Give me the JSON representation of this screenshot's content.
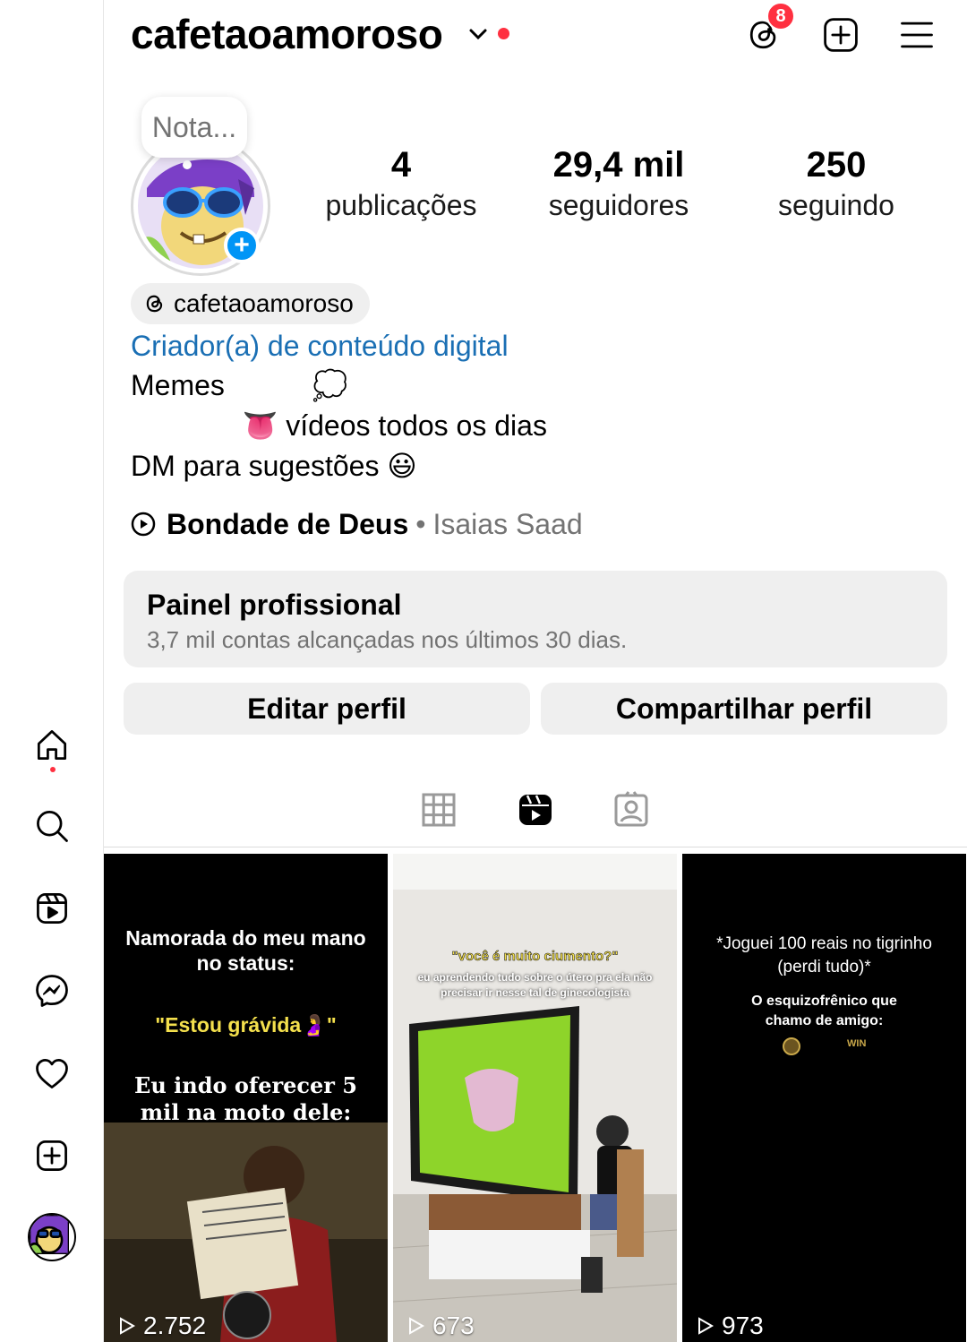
{
  "profile": {
    "username": "cafetaoamoroso",
    "note": "Nota...",
    "threads_badge_count": "8",
    "threads_handle": "cafetaoamoroso",
    "category": "Criador(a) de conteúdo digital",
    "bio_lines": [
      "Memes           💭",
      "              👅 vídeos todos os dias",
      "DM para sugestões 😃"
    ]
  },
  "stats": {
    "posts": {
      "value": "4",
      "label": "publicações"
    },
    "followers": {
      "value": "29,4 mil",
      "label": "seguidores"
    },
    "following": {
      "value": "250",
      "label": "seguindo"
    }
  },
  "music": {
    "song": "Bondade de Deus",
    "separator": "•",
    "artist": "Isaias Saad"
  },
  "panel": {
    "title": "Painel profissional",
    "subtitle": "3,7 mil contas alcançadas nos últimos 30 dias."
  },
  "buttons": {
    "edit": "Editar perfil",
    "share": "Compartilhar perfil"
  },
  "tabs": [
    {
      "icon": "grid-icon",
      "active": false
    },
    {
      "icon": "reels-icon",
      "active": true
    },
    {
      "icon": "tagged-icon",
      "active": false
    }
  ],
  "reels": [
    {
      "views": "2.752",
      "caption_top": "Namorada do meu mano no status:",
      "caption_mid": "\"Estou grávida🤰\"",
      "caption_bottom": "Eu indo oferecer 5 mil na moto dele:"
    },
    {
      "views": "673",
      "caption_top": "\"você é muito ciumento?\"",
      "caption_sub": "eu aprendendo tudo sobre o útero pra ela não precisar ir nesse tal de ginecologista"
    },
    {
      "views": "973",
      "caption_top": "*Joguei 100 reais no tigrinho (perdi tudo)*",
      "caption_mid": "O esquizofrênico que chamo de amigo:",
      "caption_small": "WIN"
    }
  ],
  "nav": [
    "home-icon",
    "search-icon",
    "reels-icon",
    "messenger-icon",
    "heart-icon",
    "create-icon",
    "profile-avatar"
  ],
  "colors": {
    "accent_blue": "#0095f6",
    "link_blue": "#1a6fb4",
    "notification_red": "#ff3040",
    "panel_gray": "#efefef"
  }
}
